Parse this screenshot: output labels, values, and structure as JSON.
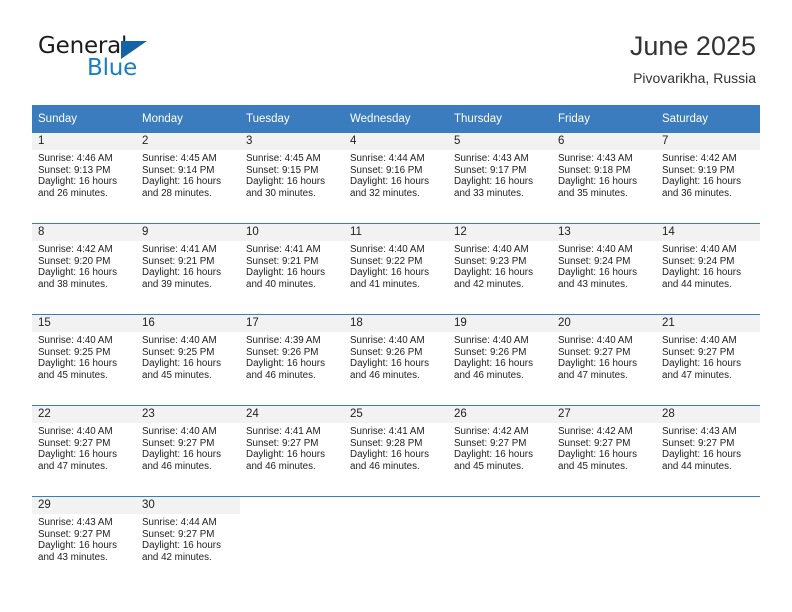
{
  "brand": {
    "word1": "General",
    "word2": "Blue",
    "logo_icon": "triangle-logo-icon"
  },
  "header": {
    "title": "June 2025",
    "location": "Pivovarikha, Russia"
  },
  "colors": {
    "header_blue": "#3a7cbe",
    "brand_blue": "#1a7dc4",
    "logo_blue": "#1464a5",
    "daynum_band": "#f2f2f2",
    "text": "#222222"
  },
  "weekdays": [
    "Sunday",
    "Monday",
    "Tuesday",
    "Wednesday",
    "Thursday",
    "Friday",
    "Saturday"
  ],
  "labels": {
    "sunrise_prefix": "Sunrise:",
    "sunset_prefix": "Sunset:",
    "daylight_prefix": "Daylight:"
  },
  "weeks": [
    {
      "days": [
        {
          "num": "1",
          "sunrise": "Sunrise: 4:46 AM",
          "sunset": "Sunset: 9:13 PM",
          "daylight1": "Daylight: 16 hours",
          "daylight2": "and 26 minutes."
        },
        {
          "num": "2",
          "sunrise": "Sunrise: 4:45 AM",
          "sunset": "Sunset: 9:14 PM",
          "daylight1": "Daylight: 16 hours",
          "daylight2": "and 28 minutes."
        },
        {
          "num": "3",
          "sunrise": "Sunrise: 4:45 AM",
          "sunset": "Sunset: 9:15 PM",
          "daylight1": "Daylight: 16 hours",
          "daylight2": "and 30 minutes."
        },
        {
          "num": "4",
          "sunrise": "Sunrise: 4:44 AM",
          "sunset": "Sunset: 9:16 PM",
          "daylight1": "Daylight: 16 hours",
          "daylight2": "and 32 minutes."
        },
        {
          "num": "5",
          "sunrise": "Sunrise: 4:43 AM",
          "sunset": "Sunset: 9:17 PM",
          "daylight1": "Daylight: 16 hours",
          "daylight2": "and 33 minutes."
        },
        {
          "num": "6",
          "sunrise": "Sunrise: 4:43 AM",
          "sunset": "Sunset: 9:18 PM",
          "daylight1": "Daylight: 16 hours",
          "daylight2": "and 35 minutes."
        },
        {
          "num": "7",
          "sunrise": "Sunrise: 4:42 AM",
          "sunset": "Sunset: 9:19 PM",
          "daylight1": "Daylight: 16 hours",
          "daylight2": "and 36 minutes."
        }
      ]
    },
    {
      "days": [
        {
          "num": "8",
          "sunrise": "Sunrise: 4:42 AM",
          "sunset": "Sunset: 9:20 PM",
          "daylight1": "Daylight: 16 hours",
          "daylight2": "and 38 minutes."
        },
        {
          "num": "9",
          "sunrise": "Sunrise: 4:41 AM",
          "sunset": "Sunset: 9:21 PM",
          "daylight1": "Daylight: 16 hours",
          "daylight2": "and 39 minutes."
        },
        {
          "num": "10",
          "sunrise": "Sunrise: 4:41 AM",
          "sunset": "Sunset: 9:21 PM",
          "daylight1": "Daylight: 16 hours",
          "daylight2": "and 40 minutes."
        },
        {
          "num": "11",
          "sunrise": "Sunrise: 4:40 AM",
          "sunset": "Sunset: 9:22 PM",
          "daylight1": "Daylight: 16 hours",
          "daylight2": "and 41 minutes."
        },
        {
          "num": "12",
          "sunrise": "Sunrise: 4:40 AM",
          "sunset": "Sunset: 9:23 PM",
          "daylight1": "Daylight: 16 hours",
          "daylight2": "and 42 minutes."
        },
        {
          "num": "13",
          "sunrise": "Sunrise: 4:40 AM",
          "sunset": "Sunset: 9:24 PM",
          "daylight1": "Daylight: 16 hours",
          "daylight2": "and 43 minutes."
        },
        {
          "num": "14",
          "sunrise": "Sunrise: 4:40 AM",
          "sunset": "Sunset: 9:24 PM",
          "daylight1": "Daylight: 16 hours",
          "daylight2": "and 44 minutes."
        }
      ]
    },
    {
      "days": [
        {
          "num": "15",
          "sunrise": "Sunrise: 4:40 AM",
          "sunset": "Sunset: 9:25 PM",
          "daylight1": "Daylight: 16 hours",
          "daylight2": "and 45 minutes."
        },
        {
          "num": "16",
          "sunrise": "Sunrise: 4:40 AM",
          "sunset": "Sunset: 9:25 PM",
          "daylight1": "Daylight: 16 hours",
          "daylight2": "and 45 minutes."
        },
        {
          "num": "17",
          "sunrise": "Sunrise: 4:39 AM",
          "sunset": "Sunset: 9:26 PM",
          "daylight1": "Daylight: 16 hours",
          "daylight2": "and 46 minutes."
        },
        {
          "num": "18",
          "sunrise": "Sunrise: 4:40 AM",
          "sunset": "Sunset: 9:26 PM",
          "daylight1": "Daylight: 16 hours",
          "daylight2": "and 46 minutes."
        },
        {
          "num": "19",
          "sunrise": "Sunrise: 4:40 AM",
          "sunset": "Sunset: 9:26 PM",
          "daylight1": "Daylight: 16 hours",
          "daylight2": "and 46 minutes."
        },
        {
          "num": "20",
          "sunrise": "Sunrise: 4:40 AM",
          "sunset": "Sunset: 9:27 PM",
          "daylight1": "Daylight: 16 hours",
          "daylight2": "and 47 minutes."
        },
        {
          "num": "21",
          "sunrise": "Sunrise: 4:40 AM",
          "sunset": "Sunset: 9:27 PM",
          "daylight1": "Daylight: 16 hours",
          "daylight2": "and 47 minutes."
        }
      ]
    },
    {
      "days": [
        {
          "num": "22",
          "sunrise": "Sunrise: 4:40 AM",
          "sunset": "Sunset: 9:27 PM",
          "daylight1": "Daylight: 16 hours",
          "daylight2": "and 47 minutes."
        },
        {
          "num": "23",
          "sunrise": "Sunrise: 4:40 AM",
          "sunset": "Sunset: 9:27 PM",
          "daylight1": "Daylight: 16 hours",
          "daylight2": "and 46 minutes."
        },
        {
          "num": "24",
          "sunrise": "Sunrise: 4:41 AM",
          "sunset": "Sunset: 9:27 PM",
          "daylight1": "Daylight: 16 hours",
          "daylight2": "and 46 minutes."
        },
        {
          "num": "25",
          "sunrise": "Sunrise: 4:41 AM",
          "sunset": "Sunset: 9:28 PM",
          "daylight1": "Daylight: 16 hours",
          "daylight2": "and 46 minutes."
        },
        {
          "num": "26",
          "sunrise": "Sunrise: 4:42 AM",
          "sunset": "Sunset: 9:27 PM",
          "daylight1": "Daylight: 16 hours",
          "daylight2": "and 45 minutes."
        },
        {
          "num": "27",
          "sunrise": "Sunrise: 4:42 AM",
          "sunset": "Sunset: 9:27 PM",
          "daylight1": "Daylight: 16 hours",
          "daylight2": "and 45 minutes."
        },
        {
          "num": "28",
          "sunrise": "Sunrise: 4:43 AM",
          "sunset": "Sunset: 9:27 PM",
          "daylight1": "Daylight: 16 hours",
          "daylight2": "and 44 minutes."
        }
      ]
    },
    {
      "days": [
        {
          "num": "29",
          "sunrise": "Sunrise: 4:43 AM",
          "sunset": "Sunset: 9:27 PM",
          "daylight1": "Daylight: 16 hours",
          "daylight2": "and 43 minutes."
        },
        {
          "num": "30",
          "sunrise": "Sunrise: 4:44 AM",
          "sunset": "Sunset: 9:27 PM",
          "daylight1": "Daylight: 16 hours",
          "daylight2": "and 42 minutes."
        },
        {
          "empty": true
        },
        {
          "empty": true
        },
        {
          "empty": true
        },
        {
          "empty": true
        },
        {
          "empty": true
        }
      ]
    }
  ]
}
